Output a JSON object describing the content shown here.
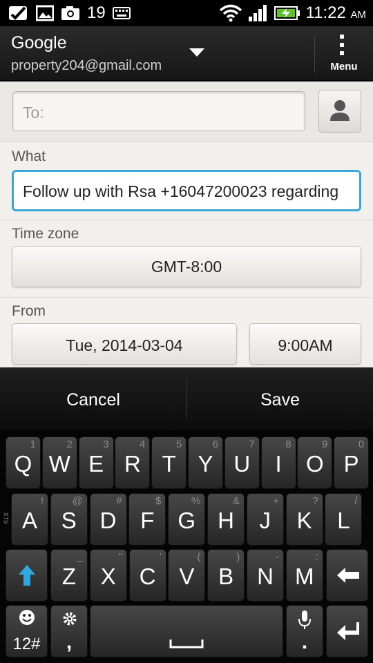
{
  "status_bar": {
    "notif_count": "19",
    "time": "11:22",
    "ampm": "AM"
  },
  "account": {
    "name": "Google",
    "email": "property204@gmail.com"
  },
  "menu": {
    "label": "Menu"
  },
  "to_field": {
    "placeholder": "To:",
    "value": ""
  },
  "what": {
    "label": "What",
    "value": "Follow up with Rsa +16047200023 regarding"
  },
  "timezone": {
    "label": "Time zone",
    "value": "GMT-8:00"
  },
  "from": {
    "label": "From",
    "date": "Tue, 2014-03-04",
    "time": "9:00AM"
  },
  "actions": {
    "cancel": "Cancel",
    "save": "Save"
  },
  "keyboard": {
    "row1": [
      {
        "key": "Q",
        "alt": "1"
      },
      {
        "key": "W",
        "alt": "2"
      },
      {
        "key": "E",
        "alt": "3"
      },
      {
        "key": "R",
        "alt": "4"
      },
      {
        "key": "T",
        "alt": "5"
      },
      {
        "key": "Y",
        "alt": "6"
      },
      {
        "key": "U",
        "alt": "7"
      },
      {
        "key": "I",
        "alt": "8"
      },
      {
        "key": "O",
        "alt": "9"
      },
      {
        "key": "P",
        "alt": "0"
      }
    ],
    "row2": [
      {
        "key": "A",
        "alt": "!"
      },
      {
        "key": "S",
        "alt": "@"
      },
      {
        "key": "D",
        "alt": "#"
      },
      {
        "key": "F",
        "alt": "$"
      },
      {
        "key": "G",
        "alt": "%"
      },
      {
        "key": "H",
        "alt": "&"
      },
      {
        "key": "J",
        "alt": "+"
      },
      {
        "key": "K",
        "alt": "?"
      },
      {
        "key": "L",
        "alt": "/"
      }
    ],
    "row3": [
      {
        "key": "Z",
        "alt": "_"
      },
      {
        "key": "X",
        "alt": "\""
      },
      {
        "key": "C",
        "alt": "'"
      },
      {
        "key": "V",
        "alt": "("
      },
      {
        "key": "B",
        "alt": ")"
      },
      {
        "key": "N",
        "alt": "-"
      },
      {
        "key": "M",
        "alt": ":"
      }
    ],
    "symbols_label": "12#",
    "comma": ",",
    "period": ".",
    "side_label": "XT9"
  },
  "colors": {
    "accent": "#3aa6d6",
    "shift_arrow": "#2fa8e0"
  }
}
